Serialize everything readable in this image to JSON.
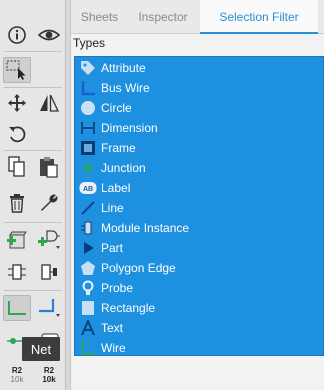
{
  "tabs": [
    {
      "label": "Sheets"
    },
    {
      "label": "Inspector"
    },
    {
      "label": "Selection Filter"
    }
  ],
  "types_label": "Types",
  "filter_items": [
    {
      "label": "Attribute",
      "icon": "tag-icon"
    },
    {
      "label": "Bus Wire",
      "icon": "bus-wire-icon"
    },
    {
      "label": "Circle",
      "icon": "circle-icon"
    },
    {
      "label": "Dimension",
      "icon": "dimension-icon"
    },
    {
      "label": "Frame",
      "icon": "frame-icon"
    },
    {
      "label": "Junction",
      "icon": "junction-icon"
    },
    {
      "label": "Label",
      "icon": "label-icon"
    },
    {
      "label": "Line",
      "icon": "line-icon"
    },
    {
      "label": "Module Instance",
      "icon": "module-instance-icon"
    },
    {
      "label": "Part",
      "icon": "part-icon"
    },
    {
      "label": "Polygon Edge",
      "icon": "polygon-icon"
    },
    {
      "label": "Probe",
      "icon": "probe-icon"
    },
    {
      "label": "Rectangle",
      "icon": "rectangle-icon"
    },
    {
      "label": "Text",
      "icon": "text-icon"
    },
    {
      "label": "Wire",
      "icon": "wire-icon"
    }
  ],
  "toolbar": {
    "label_icon_text": "AB",
    "r2_a": "R2",
    "r2_a_sub": "10k",
    "r2_b": "R2",
    "r2_b_sub": "10k"
  },
  "tooltip": "Net",
  "colors": {
    "selection_blue": "#1e90e0",
    "active_tab": "#2a8fd6",
    "wire_green": "#2fa84f"
  }
}
